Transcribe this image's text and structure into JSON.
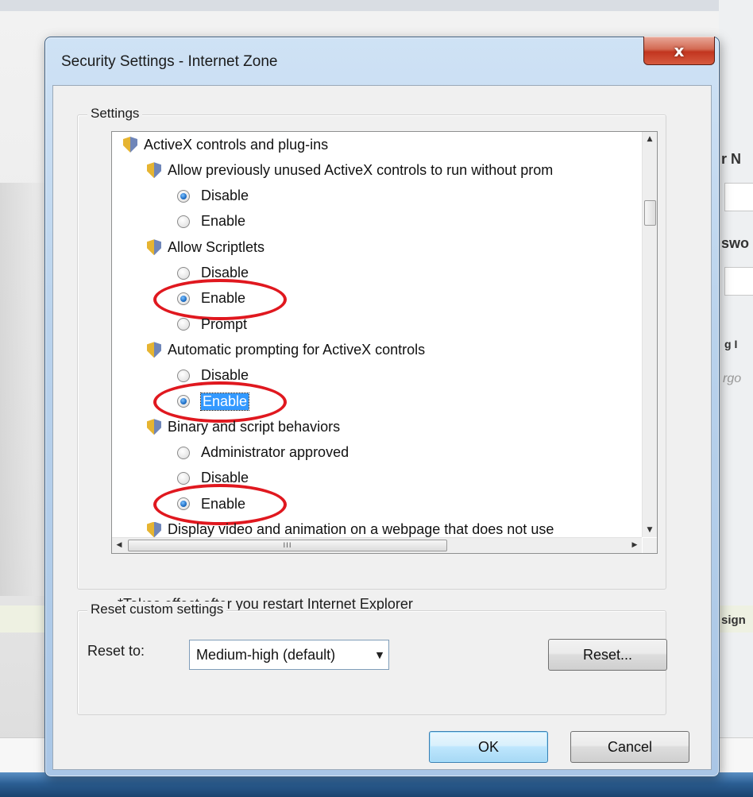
{
  "background": {
    "snippets": [
      "r N",
      "swo",
      "g I",
      "rgo",
      "sign"
    ]
  },
  "window": {
    "title": "Security Settings - Internet Zone",
    "close_label": "x"
  },
  "settings_group": {
    "label": "Settings",
    "tree": [
      {
        "kind": "category",
        "label": "ActiveX controls and plug-ins",
        "indent": 0
      },
      {
        "kind": "setting",
        "label": "Allow previously unused ActiveX controls to run without prom",
        "indent": 1
      },
      {
        "kind": "option",
        "label": "Disable",
        "checked": true,
        "indent": 2
      },
      {
        "kind": "option",
        "label": "Enable",
        "checked": false,
        "indent": 2
      },
      {
        "kind": "setting",
        "label": "Allow Scriptlets",
        "indent": 1
      },
      {
        "kind": "option",
        "label": "Disable",
        "checked": false,
        "indent": 2
      },
      {
        "kind": "option",
        "label": "Enable",
        "checked": true,
        "indent": 2,
        "circled": true
      },
      {
        "kind": "option",
        "label": "Prompt",
        "checked": false,
        "indent": 2
      },
      {
        "kind": "setting",
        "label": "Automatic prompting for ActiveX controls",
        "indent": 1
      },
      {
        "kind": "option",
        "label": "Disable",
        "checked": false,
        "indent": 2
      },
      {
        "kind": "option",
        "label": "Enable",
        "checked": true,
        "indent": 2,
        "circled": true,
        "selected": true
      },
      {
        "kind": "setting",
        "label": "Binary and script behaviors",
        "indent": 1
      },
      {
        "kind": "option",
        "label": "Administrator approved",
        "checked": false,
        "indent": 2
      },
      {
        "kind": "option",
        "label": "Disable",
        "checked": false,
        "indent": 2
      },
      {
        "kind": "option",
        "label": "Enable",
        "checked": true,
        "indent": 2,
        "circled": true
      },
      {
        "kind": "setting",
        "label": "Display video and animation on a webpage that does not use",
        "indent": 1
      }
    ],
    "hscroll_grip": "III",
    "note": "*Takes effect after you restart Internet Explorer"
  },
  "reset_group": {
    "label": "Reset custom settings",
    "reset_to_label": "Reset to:",
    "level_value": "Medium-high (default)",
    "reset_button": "Reset..."
  },
  "buttons": {
    "ok": "OK",
    "cancel": "Cancel"
  },
  "colors": {
    "annotation_circle": "#e0181f",
    "selection": "#3399ff"
  },
  "icons": {
    "category": "security-shield-icon",
    "radio": "radio-button"
  }
}
